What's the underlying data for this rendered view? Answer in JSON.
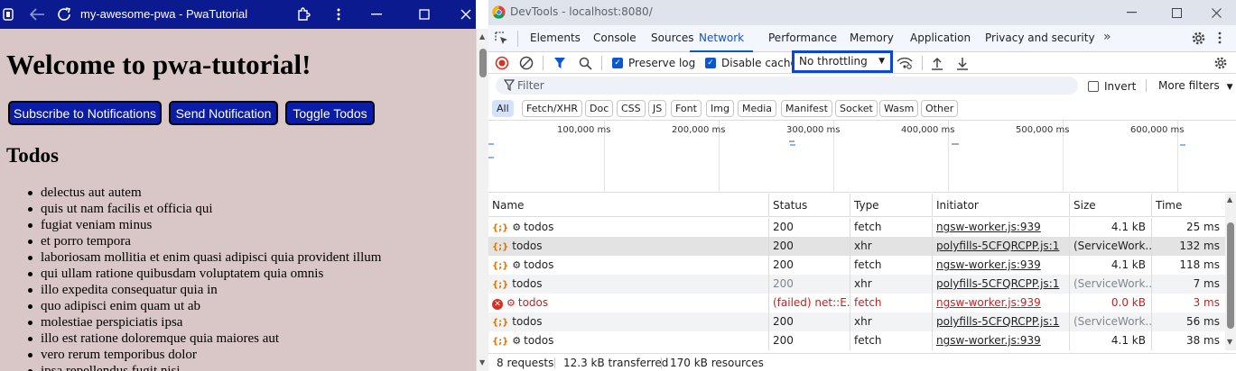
{
  "app": {
    "title": "my-awesome-pwa - PwaTutorial",
    "heading": "Welcome to pwa-tutorial!",
    "buttons": [
      "Subscribe to Notifications",
      "Send Notification",
      "Toggle Todos"
    ],
    "todos_heading": "Todos",
    "todos": [
      "delectus aut autem",
      "quis ut nam facilis et officia qui",
      "fugiat veniam minus",
      "et porro tempora",
      "laboriosam mollitia et enim quasi adipisci quia provident illum",
      "qui ullam ratione quibusdam voluptatem quia omnis",
      "illo expedita consequatur quia in",
      "quo adipisci enim quam ut ab",
      "molestiae perspiciatis ipsa",
      "illo est ratione doloremque quia maiores aut",
      "vero rerum temporibus dolor",
      "ipsa repellendus fugit nisi"
    ],
    "colors": {
      "titlebar": "#0c1a8f",
      "background": "#d9c7c7",
      "button": "#0b1da6"
    }
  },
  "devtools": {
    "title": "DevTools - localhost:8080/",
    "tabs": [
      "Elements",
      "Console",
      "Sources",
      "Network",
      "Performance",
      "Memory",
      "Application",
      "Privacy and security"
    ],
    "active_tab": "Network",
    "toolbar": {
      "preserve_log": "Preserve log",
      "disable_cache": "Disable cache",
      "throttling": "No throttling"
    },
    "filter": {
      "placeholder": "Filter",
      "invert": "Invert",
      "more_filters": "More filters"
    },
    "chips": [
      "All",
      "Fetch/XHR",
      "Doc",
      "CSS",
      "JS",
      "Font",
      "Img",
      "Media",
      "Manifest",
      "Socket",
      "Wasm",
      "Other"
    ],
    "timeline_labels": [
      "100,000 ms",
      "200,000 ms",
      "300,000 ms",
      "400,000 ms",
      "500,000 ms",
      "600,000 ms"
    ],
    "columns": [
      "Name",
      "Status",
      "Type",
      "Initiator",
      "Size",
      "Time"
    ],
    "rows": [
      {
        "icon": "fetch",
        "gear": true,
        "name": "todos",
        "status": "200",
        "type": "fetch",
        "initiator": "ngsw-worker.js:939",
        "size": "4.1 kB",
        "time": "25 ms",
        "state": "normal"
      },
      {
        "icon": "fetch",
        "gear": false,
        "name": "todos",
        "status": "200",
        "type": "xhr",
        "initiator": "polyfills-5CFQRCPP.js:1",
        "size": "(ServiceWork...",
        "time": "132 ms",
        "state": "selected"
      },
      {
        "icon": "fetch",
        "gear": true,
        "name": "todos",
        "status": "200",
        "type": "fetch",
        "initiator": "ngsw-worker.js:939",
        "size": "4.1 kB",
        "time": "118 ms",
        "state": "normal"
      },
      {
        "icon": "fetch",
        "gear": false,
        "name": "todos",
        "status": "200",
        "type": "xhr",
        "initiator": "polyfills-5CFQRCPP.js:1",
        "size": "(ServiceWork...",
        "time": "7 ms",
        "state": "dim"
      },
      {
        "icon": "error",
        "gear": true,
        "name": "todos",
        "status": "(failed) net::E...",
        "type": "fetch",
        "initiator": "ngsw-worker.js:939",
        "size": "0.0 kB",
        "time": "3 ms",
        "state": "error"
      },
      {
        "icon": "fetch",
        "gear": false,
        "name": "todos",
        "status": "200",
        "type": "xhr",
        "initiator": "polyfills-5CFQRCPP.js:1",
        "size": "(ServiceWork...",
        "time": "56 ms",
        "state": "dim"
      },
      {
        "icon": "fetch",
        "gear": true,
        "name": "todos",
        "status": "200",
        "type": "fetch",
        "initiator": "ngsw-worker.js:939",
        "size": "4.1 kB",
        "time": "38 ms",
        "state": "normal"
      }
    ],
    "status_bar": [
      "8 requests",
      "12.3 kB transferred",
      "170 kB resources"
    ],
    "colors": {
      "accent": "#0b57d0",
      "highlight_box": "#0b46d8",
      "error": "#c5221f"
    }
  }
}
